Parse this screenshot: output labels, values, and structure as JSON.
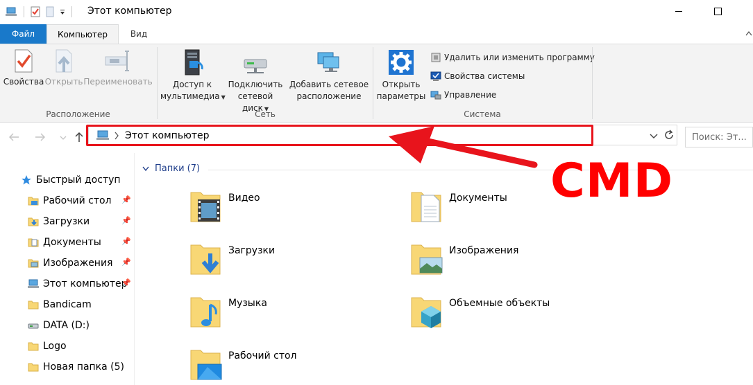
{
  "window": {
    "title": "Этот компьютер"
  },
  "tabs": [
    {
      "label": "Файл"
    },
    {
      "label": "Компьютер"
    },
    {
      "label": "Вид"
    }
  ],
  "ribbon": {
    "location_group": {
      "label": "Расположение",
      "properties": "Свойства",
      "open": "Открыть",
      "rename": "Переименовать"
    },
    "network_group": {
      "label": "Сеть",
      "media_line1": "Доступ к",
      "media_line2": "мультимедиа",
      "map_line1": "Подключить",
      "map_line2": "сетевой диск",
      "add_line1": "Добавить сетевое",
      "add_line2": "расположение"
    },
    "system_group": {
      "label": "Система",
      "settings_line1": "Открыть",
      "settings_line2": "параметры",
      "uninstall": "Удалить или изменить программу",
      "sys_props": "Свойства системы",
      "manage": "Управление"
    }
  },
  "address_bar": {
    "path": "Этот компьютер",
    "search_placeholder": "Поиск: Эт..."
  },
  "nav_pane": {
    "items": [
      {
        "label": "Быстрый доступ",
        "icon": "star-icon"
      },
      {
        "label": "Рабочий стол",
        "icon": "folder-icon",
        "pinned": true
      },
      {
        "label": "Загрузки",
        "icon": "download-folder-icon",
        "pinned": true
      },
      {
        "label": "Документы",
        "icon": "documents-folder-icon",
        "pinned": true
      },
      {
        "label": "Изображения",
        "icon": "pictures-folder-icon",
        "pinned": true
      },
      {
        "label": "Этот компьютер",
        "icon": "computer-icon",
        "pinned": true
      },
      {
        "label": "Bandicam",
        "icon": "folder-icon"
      },
      {
        "label": "DATA (D:)",
        "icon": "drive-icon"
      },
      {
        "label": "Logo",
        "icon": "folder-icon"
      },
      {
        "label": "Новая папка (5)",
        "icon": "folder-icon"
      }
    ]
  },
  "content": {
    "section_title": "Папки (7)",
    "folders": [
      {
        "label": "Видео",
        "icon": "video-folder-icon"
      },
      {
        "label": "Документы",
        "icon": "documents-folder-icon"
      },
      {
        "label": "Загрузки",
        "icon": "download-folder-icon"
      },
      {
        "label": "Изображения",
        "icon": "pictures-folder-icon"
      },
      {
        "label": "Музыка",
        "icon": "music-folder-icon"
      },
      {
        "label": "Объемные объекты",
        "icon": "3d-objects-folder-icon"
      },
      {
        "label": "Рабочий стол",
        "icon": "desktop-folder-icon"
      }
    ]
  },
  "annotation": {
    "label": "CMD",
    "color": "#ff0000"
  },
  "colors": {
    "accent": "#1979ca",
    "folder": "#f8d775",
    "annotation": "#e8141c"
  }
}
